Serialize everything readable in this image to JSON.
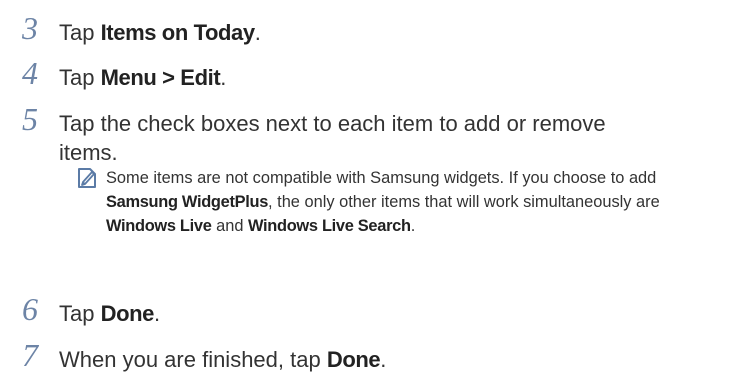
{
  "steps": [
    {
      "num": "3",
      "pre": "Tap ",
      "bold": "Items on Today",
      "post": "."
    },
    {
      "num": "4",
      "pre": "Tap ",
      "bold": "Menu > Edit",
      "post": "."
    },
    {
      "num": "5",
      "text": "Tap the check boxes next to each item to add or remove items."
    },
    {
      "num": "6",
      "pre": "Tap ",
      "bold": "Done",
      "post": "."
    },
    {
      "num": "7",
      "pre": "When you are finished, tap ",
      "bold": "Done",
      "post": "."
    }
  ],
  "note": {
    "icon": "note-pencil-icon",
    "part1": "Some items are not compatible with Samsung widgets. If you choose to add ",
    "bold1": "Samsung WidgetPlus",
    "part2": ", the only other items that will work simultaneously are ",
    "bold2": "Windows Live",
    "part3": " and ",
    "bold3": "Windows Live Search",
    "part4": "."
  },
  "colors": {
    "step_number": "#6d84a6",
    "note_icon": "#5b7ba6"
  }
}
